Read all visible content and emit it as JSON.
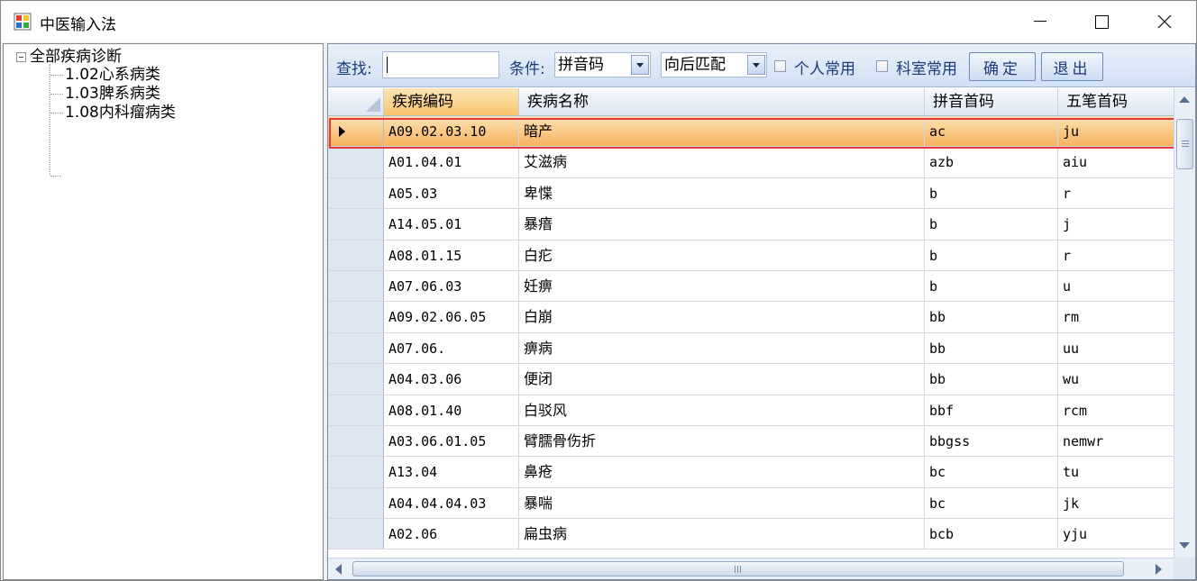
{
  "window": {
    "title": "中医输入法",
    "icons": {
      "app": "app-icon",
      "minimize": "minimize-icon",
      "maximize": "maximize-icon",
      "close": "close-icon"
    }
  },
  "tree": {
    "root_label": "全部疾病诊断",
    "children": [
      "1.02心系病类",
      "1.03脾系病类",
      "1.08内科瘤病类"
    ]
  },
  "toolbar": {
    "search_label": "查找:",
    "search_value": "",
    "condition_label": "条件:",
    "condition_value": "拼音码",
    "match_value": "向后匹配",
    "personal_label": "个人常用",
    "dept_label": "科室常用",
    "ok_label": "确定",
    "exit_label": "退出"
  },
  "grid": {
    "columns": [
      "疾病编码",
      "疾病名称",
      "拼音首码",
      "五笔首码"
    ],
    "rows": [
      [
        "A09.02.03.10",
        "暗产",
        "ac",
        "ju"
      ],
      [
        "A01.04.01",
        "艾滋病",
        "azb",
        "aiu"
      ],
      [
        "A05.03",
        "卑惵",
        "b",
        "r"
      ],
      [
        "A14.05.01",
        "暴瘖",
        "b",
        "j"
      ],
      [
        "A08.01.15",
        "白疕",
        "b",
        "r"
      ],
      [
        "A07.06.03",
        "妊痹",
        "b",
        "u"
      ],
      [
        "A09.02.06.05",
        "白崩",
        "bb",
        "rm"
      ],
      [
        "A07.06.",
        "痹病",
        "bb",
        "uu"
      ],
      [
        "A04.03.06",
        "便闭",
        "bb",
        "wu"
      ],
      [
        "A08.01.40",
        "白驳风",
        "bbf",
        "rcm"
      ],
      [
        "A03.06.01.05",
        "臂臑骨伤折",
        "bbgss",
        "nemwr"
      ],
      [
        "A13.04",
        "鼻疮",
        "bc",
        "tu"
      ],
      [
        "A04.04.04.03",
        "暴喘",
        "bc",
        "jk"
      ],
      [
        "A02.06",
        "扁虫病",
        "bcb",
        "yju"
      ]
    ],
    "selected_row": 0
  },
  "colors": {
    "selection_outline": "#e0393e",
    "selected_row": "#f5b25e",
    "accent_text": "#1a3a78"
  }
}
